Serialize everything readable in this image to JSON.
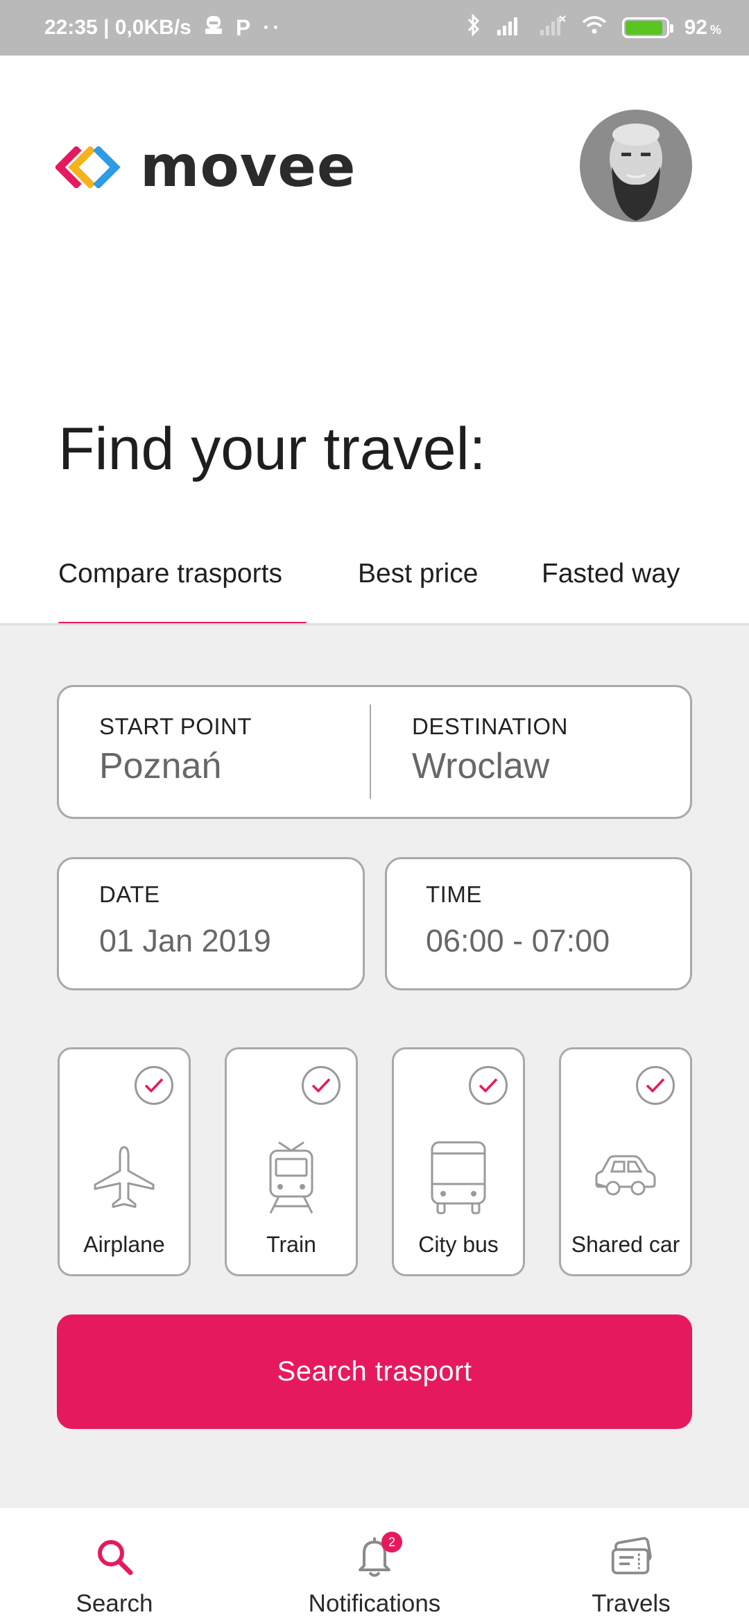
{
  "status_bar": {
    "time_speed": "22:35 | 0,0KB/s",
    "battery_percent": "92",
    "battery_unit": "%",
    "battery_level": 0.92
  },
  "header": {
    "logo_text": "movee",
    "brand_colors": [
      "#e6195f",
      "#f6b21b",
      "#2e9be6"
    ]
  },
  "main": {
    "title": "Find your travel:",
    "tabs": [
      {
        "label": "Compare trasports",
        "active": true
      },
      {
        "label": "Best price",
        "active": false
      },
      {
        "label": "Fasted way",
        "active": false
      }
    ]
  },
  "form": {
    "start": {
      "label": "START POINT",
      "value": "Poznań"
    },
    "destination": {
      "label": "DESTINATION",
      "value": "Wroclaw"
    },
    "date": {
      "label": "DATE",
      "value": "01 Jan 2019"
    },
    "time": {
      "label": "TIME",
      "value": "06:00 - 07:00"
    },
    "modes": [
      {
        "label": "Airplane",
        "icon": "airplane-icon",
        "checked": true
      },
      {
        "label": "Train",
        "icon": "train-icon",
        "checked": true
      },
      {
        "label": "City bus",
        "icon": "bus-icon",
        "checked": true
      },
      {
        "label": "Shared car",
        "icon": "car-icon",
        "checked": true
      }
    ],
    "search_label": "Search trasport"
  },
  "bottom_nav": {
    "items": [
      {
        "label": "Search",
        "icon": "search-icon",
        "active": true
      },
      {
        "label": "Notifications",
        "icon": "bell-icon",
        "badge": "2"
      },
      {
        "label": "Travels",
        "icon": "tickets-icon"
      }
    ]
  },
  "colors": {
    "accent": "#e6195f",
    "border": "#a9a9a9",
    "form_bg": "#efefef"
  }
}
